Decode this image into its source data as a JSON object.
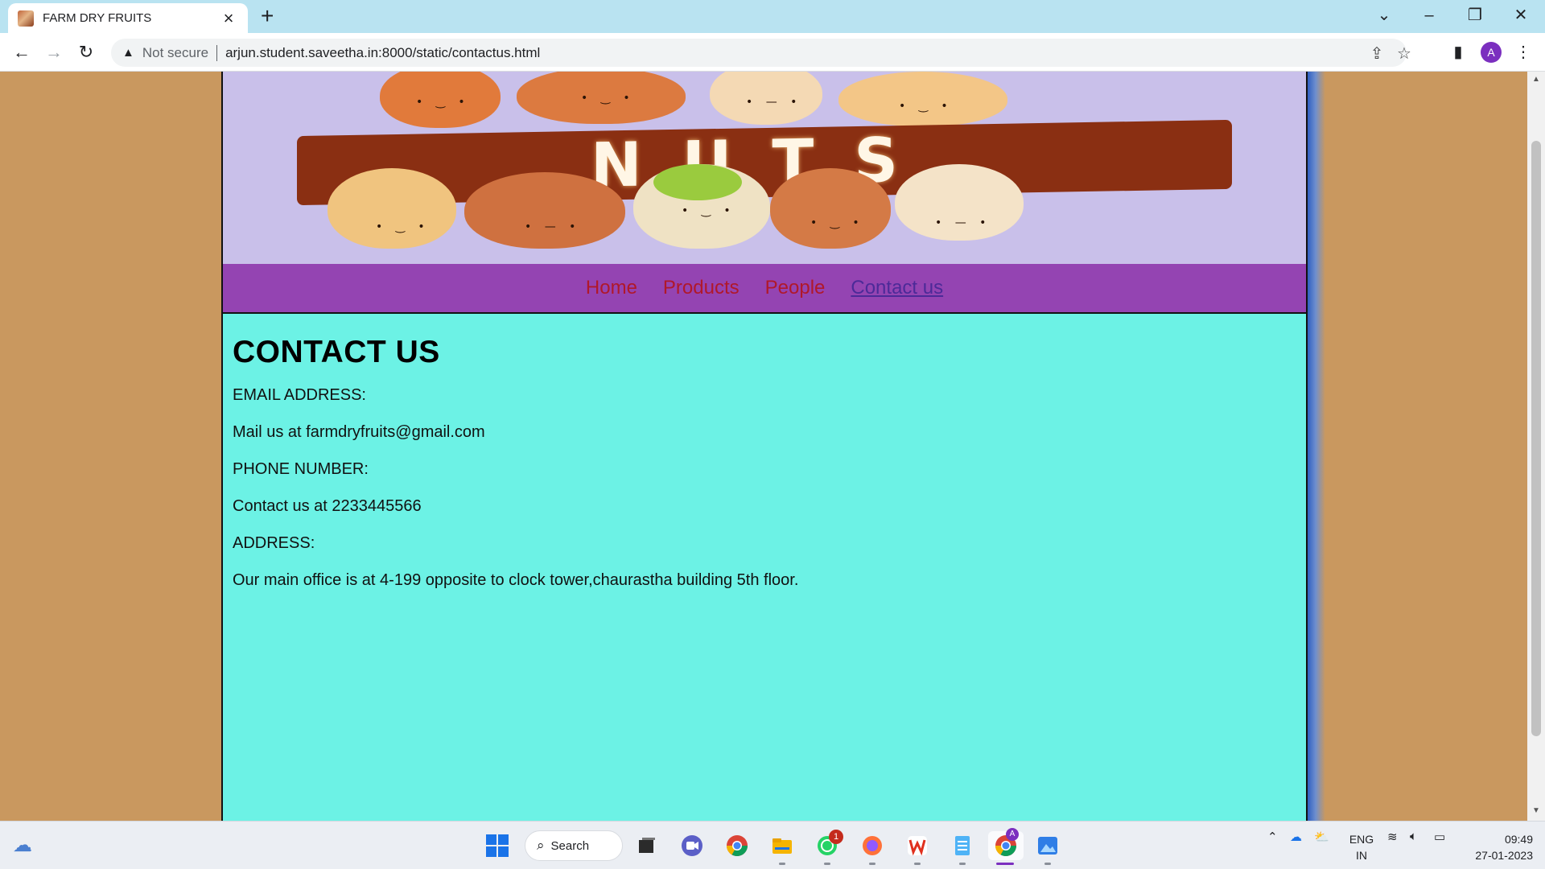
{
  "browser": {
    "tab_title": "FARM DRY FRUITS",
    "tab_close": "×",
    "new_tab": "+",
    "security_label": "Not secure",
    "url": "arjun.student.saveetha.in:8000/static/contactus.html",
    "profile_initial": "A"
  },
  "page": {
    "banner": {
      "logo_text": "NUTS"
    },
    "nav": [
      {
        "label": "Home",
        "active": false
      },
      {
        "label": "Products",
        "active": false
      },
      {
        "label": "People",
        "active": false
      },
      {
        "label": "Contact us",
        "active": true
      }
    ],
    "heading": "CONTACT US",
    "lines": [
      "EMAIL ADDRESS:",
      "Mail us at farmdryfruits@gmail.com",
      "PHONE NUMBER:",
      "Contact us at 2233445566",
      "ADDRESS:",
      "Our main office is at 4-199 opposite to clock tower,chaurastha building 5th floor."
    ]
  },
  "colors": {
    "page_bg": "#c9985f",
    "nav_bg": "#9444b2",
    "nav_link": "#b0182a",
    "nav_active": "#4c2a98",
    "content_bg": "#6cf2e5",
    "banner_bg": "#c9c0ea"
  },
  "taskbar": {
    "search_label": "Search",
    "whatsapp_badge": "1",
    "chrome_badge": "A",
    "language_line1": "ENG",
    "language_line2": "IN",
    "time": "09:49",
    "date": "27-01-2023",
    "apps": [
      "windows-start-icon",
      "task-view-icon",
      "meet-icon",
      "chrome-icon",
      "file-explorer-icon",
      "whatsapp-icon",
      "firefox-icon",
      "wps-office-icon",
      "notepad-icon",
      "chrome-active-icon",
      "photos-icon"
    ]
  }
}
